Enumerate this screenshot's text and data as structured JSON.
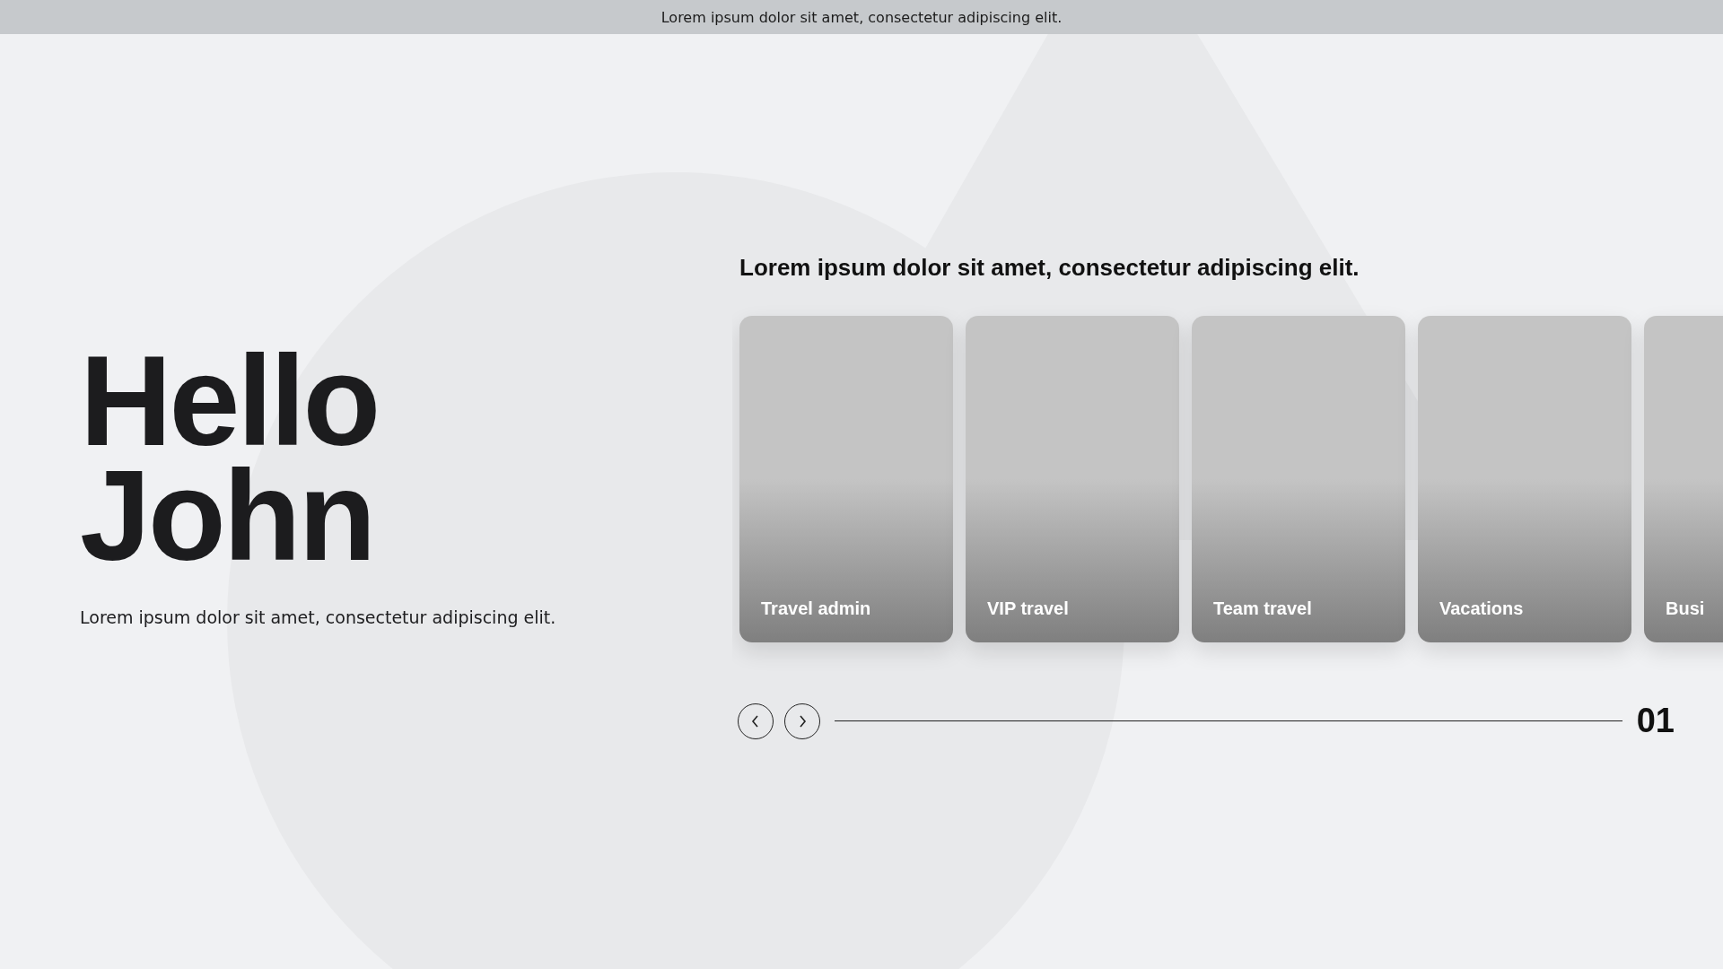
{
  "top_bar": {
    "text": "Lorem ipsum dolor sit amet, consectetur adipiscing elit."
  },
  "greeting": {
    "lines": [
      "Hello",
      "John"
    ],
    "subtitle": "Lorem ipsum dolor sit amet, consectetur adipiscing elit."
  },
  "carousel": {
    "heading": "Lorem ipsum dolor sit amet, consectetur adipiscing elit.",
    "cards": [
      {
        "label": "Travel admin"
      },
      {
        "label": "VIP travel"
      },
      {
        "label": "Team travel"
      },
      {
        "label": "Vacations"
      },
      {
        "label": "Busi"
      }
    ],
    "page": "01"
  }
}
